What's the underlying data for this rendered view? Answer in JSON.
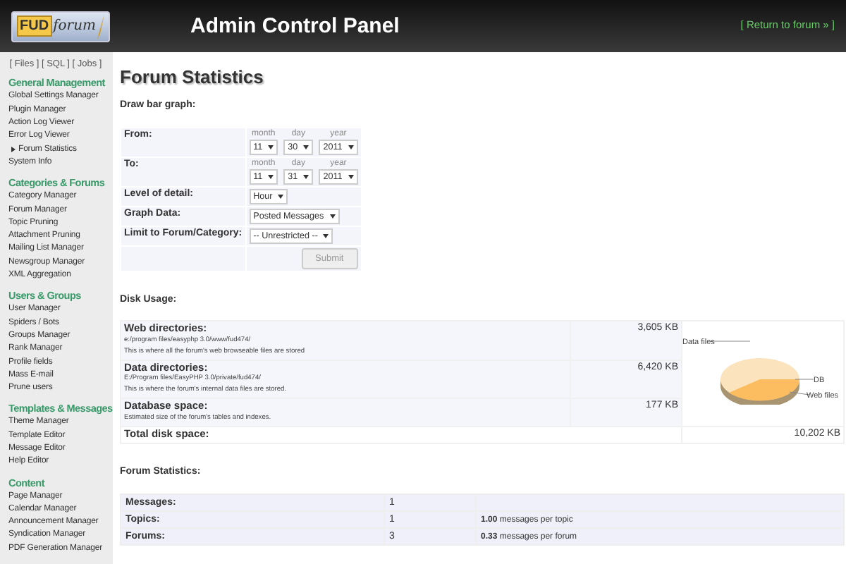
{
  "header": {
    "logo": {
      "boxed": "FUD",
      "script": "forum"
    },
    "title": "Admin Control Panel",
    "return_link": "[ Return to forum » ]"
  },
  "sidebar": {
    "top_links": "[ Files ] [ SQL ] [ Jobs ]",
    "sections": [
      {
        "title": "General Management",
        "items": [
          {
            "label": "Global Settings Manager",
            "selected": false
          },
          {
            "label": "Plugin Manager",
            "selected": false
          },
          {
            "label": "Action Log Viewer",
            "selected": false
          },
          {
            "label": "Error Log Viewer",
            "selected": false
          },
          {
            "label": "Forum Statistics",
            "selected": true
          },
          {
            "label": "System Info",
            "selected": false
          }
        ]
      },
      {
        "title": "Categories & Forums",
        "items": [
          {
            "label": "Category Manager",
            "selected": false
          },
          {
            "label": "Forum Manager",
            "selected": false
          },
          {
            "label": "Topic Pruning",
            "selected": false
          },
          {
            "label": "Attachment Pruning",
            "selected": false
          },
          {
            "label": "Mailing List Manager",
            "selected": false
          },
          {
            "label": "Newsgroup Manager",
            "selected": false
          },
          {
            "label": "XML Aggregation",
            "selected": false
          }
        ]
      },
      {
        "title": "Users & Groups",
        "items": [
          {
            "label": "User Manager",
            "selected": false
          },
          {
            "label": "Spiders / Bots",
            "selected": false
          },
          {
            "label": "Groups Manager",
            "selected": false
          },
          {
            "label": "Rank Manager",
            "selected": false
          },
          {
            "label": "Profile fields",
            "selected": false
          },
          {
            "label": "Mass E-mail",
            "selected": false
          },
          {
            "label": "Prune users",
            "selected": false
          }
        ]
      },
      {
        "title": "Templates & Messages",
        "items": [
          {
            "label": "Theme Manager",
            "selected": false
          },
          {
            "label": "Template Editor",
            "selected": false
          },
          {
            "label": "Message Editor",
            "selected": false
          },
          {
            "label": "Help Editor",
            "selected": false
          }
        ]
      },
      {
        "title": "Content",
        "items": [
          {
            "label": "Page Manager",
            "selected": false
          },
          {
            "label": "Calendar Manager",
            "selected": false
          },
          {
            "label": "Announcement Manager",
            "selected": false
          },
          {
            "label": "Syndication Manager",
            "selected": false
          },
          {
            "label": "PDF Generation Manager",
            "selected": false
          }
        ]
      }
    ]
  },
  "page_title": "Forum Statistics",
  "bar_graph": {
    "heading": "Draw bar graph:",
    "fields": [
      {
        "kind": "date",
        "label": "From:",
        "parts": [
          {
            "caption": "month",
            "value": "11"
          },
          {
            "caption": "day",
            "value": "30"
          },
          {
            "caption": "year",
            "value": "2011"
          }
        ]
      },
      {
        "kind": "date",
        "label": "To:",
        "parts": [
          {
            "caption": "month",
            "value": "11"
          },
          {
            "caption": "day",
            "value": "31"
          },
          {
            "caption": "year",
            "value": "2011"
          }
        ]
      },
      {
        "kind": "select",
        "label": "Level of detail:",
        "value": "Hour"
      },
      {
        "kind": "select",
        "label": "Graph Data:",
        "value": "Posted Messages"
      },
      {
        "kind": "select",
        "label": "Limit to Forum/Category:",
        "value": "-- Unrestricted --"
      }
    ],
    "submit": "Submit"
  },
  "disk_usage": {
    "heading": "Disk Usage:",
    "rows": [
      {
        "label": "Web directories:",
        "path": "e:/program files/easyphp 3.0/www/fud474/",
        "description": "This is where all the forum's web browseable files are stored",
        "value": "3,605 KB"
      },
      {
        "label": "Data directories:",
        "path": "E:/Program files/EasyPHP 3.0/private/fud474/",
        "description": "This is where the forum's internal data files are stored.",
        "value": "6,420 KB"
      },
      {
        "label": "Database space:",
        "description": "Estimated size of the forum's tables and indexes.",
        "value": "177 KB"
      }
    ],
    "total": {
      "label": "Total disk space:",
      "value": "10,202 KB"
    },
    "pie_labels": [
      "Data files",
      "DB",
      "Web files"
    ]
  },
  "forum_statistics": {
    "heading": "Forum Statistics:",
    "rows": [
      {
        "label": "Messages:",
        "count": "1"
      },
      {
        "label": "Topics:",
        "count": "1",
        "note": "**1.00** messages per topic"
      },
      {
        "label": "Forums:",
        "count": "3",
        "note": "**0.33** messages per forum"
      }
    ]
  }
}
